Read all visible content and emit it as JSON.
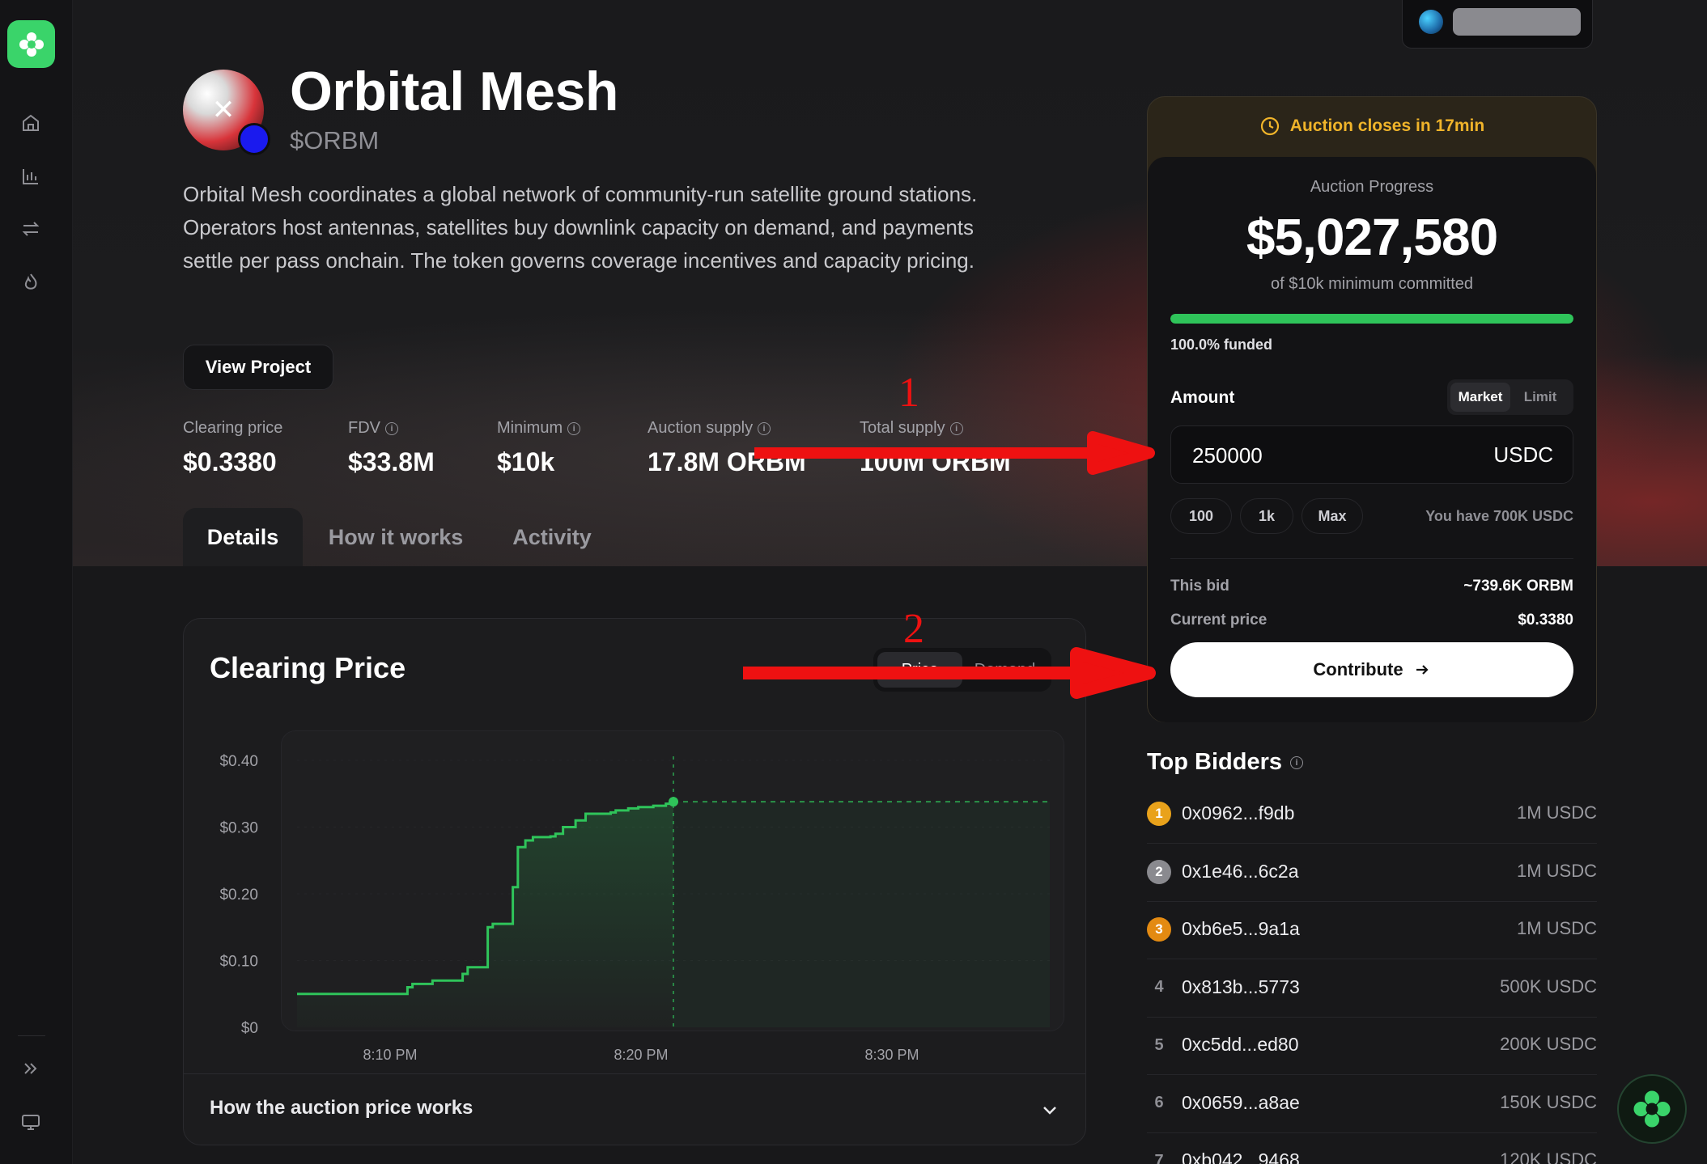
{
  "nav": {
    "items": [
      "home-icon",
      "chart-icon",
      "swap-icon",
      "flame-icon"
    ],
    "bottom": [
      "expand-icon",
      "monitor-icon"
    ]
  },
  "project": {
    "name": "Orbital Mesh",
    "ticker": "$ORBM",
    "description": "Orbital Mesh coordinates a global network of community-run satellite ground stations. Operators host antennas, satellites buy downlink capacity on demand, and payments settle per pass onchain. The token governs coverage incentives and capacity pricing.",
    "view_button": "View Project"
  },
  "stats": [
    {
      "label": "Clearing price",
      "value": "$0.3380",
      "info": false
    },
    {
      "label": "FDV",
      "value": "$33.8M",
      "info": true
    },
    {
      "label": "Minimum",
      "value": "$10k",
      "info": true
    },
    {
      "label": "Auction supply",
      "value": "17.8M ORBM",
      "info": true
    },
    {
      "label": "Total supply",
      "value": "100M ORBM",
      "info": true
    }
  ],
  "tabs": [
    "Details",
    "How it works",
    "Activity"
  ],
  "chart": {
    "title": "Clearing Price",
    "toggle": [
      "Price",
      "Demand"
    ],
    "accordion_label": "How the auction price works"
  },
  "chart_data": {
    "type": "line",
    "title": "Clearing Price",
    "xlabel": "",
    "ylabel": "",
    "x_ticks": [
      "8:10 PM",
      "8:20 PM",
      "8:30 PM"
    ],
    "y_ticks": [
      "$0.40",
      "$0.30",
      "$0.20",
      "$0.10",
      "$0"
    ],
    "ylim": [
      0,
      0.4
    ],
    "xlim_minutes": [
      0,
      30
    ],
    "step": true,
    "series": [
      {
        "x_minutes": [
          0,
          4.4,
          4.6,
          5.4,
          6.6,
          6.8,
          7.6,
          7.8,
          8.6,
          8.8,
          9.1,
          9.4,
          10.1,
          10.3,
          10.6,
          11.1,
          11.5,
          12.5,
          12.7,
          13.2,
          13.6,
          14.2,
          14.7,
          15.0
        ],
        "values": [
          0.05,
          0.06,
          0.065,
          0.07,
          0.08,
          0.09,
          0.15,
          0.155,
          0.21,
          0.27,
          0.28,
          0.285,
          0.286,
          0.29,
          0.3,
          0.31,
          0.32,
          0.322,
          0.325,
          0.328,
          0.33,
          0.332,
          0.335,
          0.338
        ]
      }
    ],
    "current": {
      "x_minutes": 15.0,
      "value": 0.338
    },
    "grid": false,
    "colors": {
      "line": "#2fc45a",
      "projection": "#2fc45a"
    }
  },
  "auction": {
    "banner": "Auction closes in 17min",
    "progress_label": "Auction Progress",
    "amount": "$5,027,580",
    "subtitle": "of $10k minimum committed",
    "funded_pct": 100.0,
    "funded_label": "100.0% funded",
    "amount_label": "Amount",
    "modes": [
      "Market",
      "Limit"
    ],
    "input_value": "250000",
    "currency": "USDC",
    "chips": [
      "100",
      "1k",
      "Max"
    ],
    "balance": "You have 700K USDC",
    "this_bid_label": "This bid",
    "this_bid_value": "~739.6K ORBM",
    "current_price_label": "Current price",
    "current_price_value": "$0.3380",
    "contribute": "Contribute"
  },
  "bidders": {
    "title": "Top Bidders",
    "items": [
      {
        "rank": "1",
        "address": "0x0962...f9db",
        "amount": "1M USDC",
        "color": "#e9a21b"
      },
      {
        "rank": "2",
        "address": "0x1e46...6c2a",
        "amount": "1M USDC",
        "color": "#8a8a8f"
      },
      {
        "rank": "3",
        "address": "0xb6e5...9a1a",
        "amount": "1M USDC",
        "color": "#e38a12"
      },
      {
        "rank": "4",
        "address": "0x813b...5773",
        "amount": "500K USDC",
        "color": ""
      },
      {
        "rank": "5",
        "address": "0xc5dd...ed80",
        "amount": "200K USDC",
        "color": ""
      },
      {
        "rank": "6",
        "address": "0x0659...a8ae",
        "amount": "150K USDC",
        "color": ""
      },
      {
        "rank": "7",
        "address": "0xb042...9468",
        "amount": "120K USDC",
        "color": ""
      }
    ]
  },
  "annotations": {
    "marker_1": "1",
    "marker_2": "2",
    "color": "#ee1111"
  }
}
